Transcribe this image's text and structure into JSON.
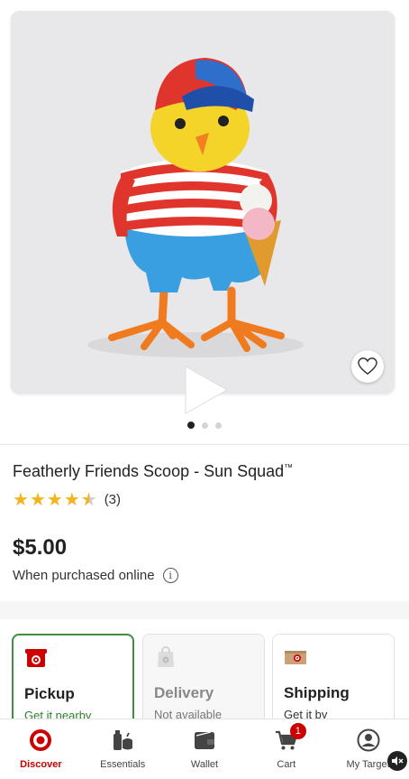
{
  "product": {
    "title": "Featherly Friends Scoop - Sun Squad",
    "trademark": "™",
    "rating_count": "(3)",
    "rating_value": 4.5,
    "price": "$5.00",
    "price_note": "When purchased online",
    "info_glyph": "i"
  },
  "gallery": {
    "image_count": 3,
    "active_index": 0
  },
  "fulfillment": [
    {
      "title": "Pickup",
      "subtitle": "Get it nearby",
      "state": "selected",
      "icon": "store-icon"
    },
    {
      "title": "Delivery",
      "subtitle": "Not available",
      "state": "disabled",
      "icon": "delivery-bag-icon"
    },
    {
      "title": "Shipping",
      "subtitle": "Get it by",
      "state": "default",
      "icon": "shipping-box-icon"
    }
  ],
  "tabs": [
    {
      "label": "Discover",
      "icon": "target-logo-icon",
      "active": true
    },
    {
      "label": "Essentials",
      "icon": "essentials-icon",
      "active": false
    },
    {
      "label": "Wallet",
      "icon": "wallet-icon",
      "active": false
    },
    {
      "label": "Cart",
      "icon": "cart-icon",
      "active": false,
      "badge": "1"
    },
    {
      "label": "My Target",
      "icon": "account-icon",
      "active": false
    }
  ],
  "colors": {
    "brand_red": "#cc0000",
    "star": "#f2b51b",
    "pickup_green": "#3f8f3f"
  }
}
